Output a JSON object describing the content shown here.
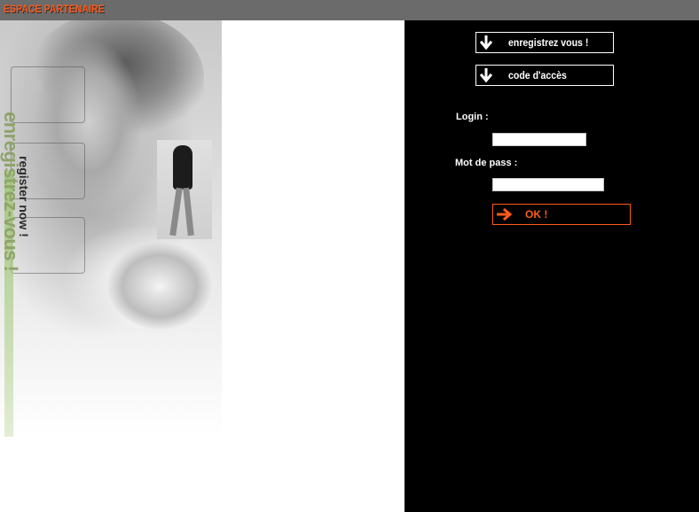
{
  "header": {
    "title": "ESPACE PARTENAIRE"
  },
  "nav": {
    "register_label": "enregistrez vous !",
    "access_code_label": "code d'accès"
  },
  "login": {
    "login_label": "Login :",
    "login_value": "",
    "password_label": "Mot de pass :",
    "password_value": "",
    "ok_label": "OK !"
  },
  "banner": {
    "slogan_main": "enregistrez-vous !",
    "slogan_sub": "register now !"
  },
  "colors": {
    "accent": "#ff5a1a",
    "topbar": "#6b6b6b",
    "background": "#000000"
  },
  "icons": {
    "nav_arrow": "arrow-down-icon",
    "ok_arrow": "arrow-right-icon"
  }
}
